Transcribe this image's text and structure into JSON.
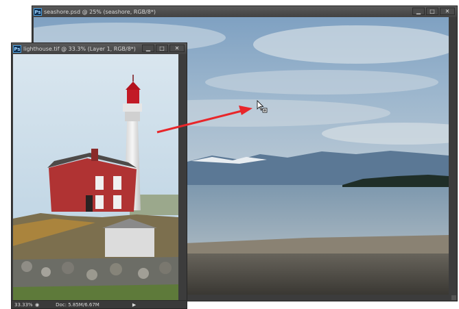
{
  "background_window": {
    "title": "seashore.psd @ 25% (seashore, RGB/8*)",
    "app_badge": "Ps",
    "controls": {
      "minimize": "▁",
      "maximize": "□",
      "close": "✕"
    }
  },
  "front_window": {
    "title": "lighthouse.tif @ 33.3% (Layer 1, RGB/8*)",
    "app_badge": "Ps",
    "controls": {
      "minimize": "▁",
      "maximize": "□",
      "close": "✕"
    },
    "status": {
      "zoom": "33.33%",
      "doc_size": "Doc: 5.85M/6.67M",
      "menu_arrow": "▶"
    }
  },
  "drag_arrow": {
    "color": "#e8262a"
  },
  "icons": {
    "cursor": "arrow-cursor-with-plus-icon",
    "app": "photoshop-icon",
    "status_menu": "status-arrow-icon"
  }
}
